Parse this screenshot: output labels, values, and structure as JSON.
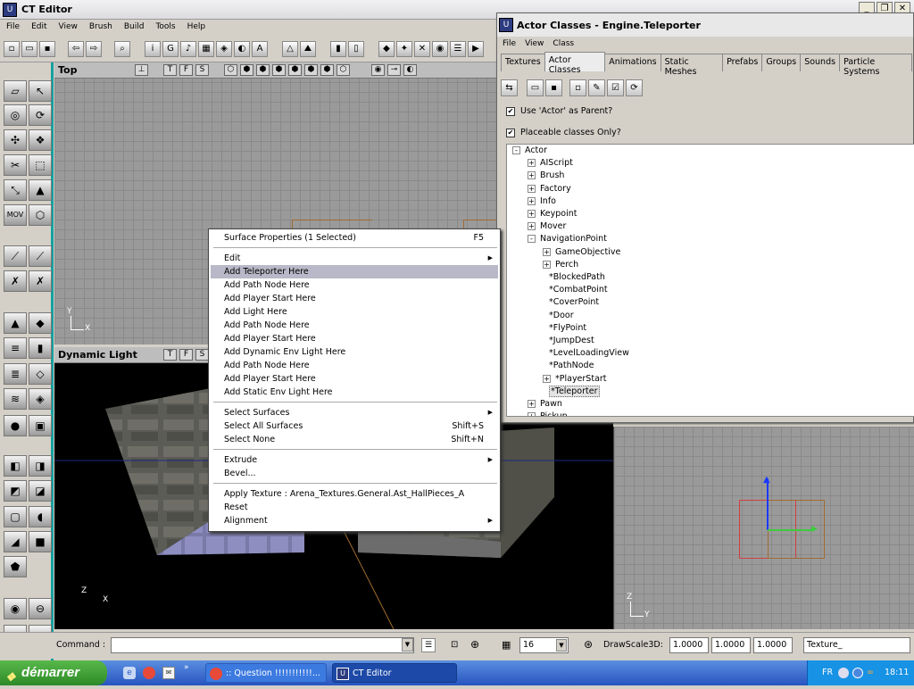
{
  "app": {
    "title": "CT Editor"
  },
  "menubar": [
    "File",
    "Edit",
    "View",
    "Brush",
    "Build",
    "Tools",
    "Help"
  ],
  "viewports": {
    "top": {
      "name": "Top",
      "buttons": [
        "T",
        "F",
        "S"
      ],
      "axis_y": "Y",
      "axis_x": "X"
    },
    "dynamic": {
      "name": "Dynamic Light",
      "buttons": [
        "T",
        "F",
        "S"
      ]
    },
    "side": {
      "axis_z": "Z",
      "axis_y": "Y"
    }
  },
  "actor_classes": {
    "title": "Actor Classes - Engine.Teleporter",
    "menu": [
      "File",
      "View",
      "Class"
    ],
    "tabs": [
      "Textures",
      "Actor Classes",
      "Animations",
      "Static Meshes",
      "Prefabs",
      "Groups",
      "Sounds",
      "Particle Systems"
    ],
    "active_tab": "Actor Classes",
    "use_actor_parent": "Use 'Actor' as Parent?",
    "placeable_only": "Placeable classes Only?",
    "tree": [
      {
        "label": "Actor",
        "level": 0,
        "expander": "-"
      },
      {
        "label": "AIScript",
        "level": 1,
        "expander": "+"
      },
      {
        "label": "Brush",
        "level": 1,
        "expander": "+"
      },
      {
        "label": "Factory",
        "level": 1,
        "expander": "+"
      },
      {
        "label": "Info",
        "level": 1,
        "expander": "+"
      },
      {
        "label": "Keypoint",
        "level": 1,
        "expander": "+"
      },
      {
        "label": "Mover",
        "level": 1,
        "expander": "+"
      },
      {
        "label": "NavigationPoint",
        "level": 1,
        "expander": "-"
      },
      {
        "label": "GameObjective",
        "level": 2,
        "expander": "+"
      },
      {
        "label": "Perch",
        "level": 2,
        "expander": "+"
      },
      {
        "label": "*BlockedPath",
        "level": 2,
        "expander": ""
      },
      {
        "label": "*CombatPoint",
        "level": 2,
        "expander": ""
      },
      {
        "label": "*CoverPoint",
        "level": 2,
        "expander": ""
      },
      {
        "label": "*Door",
        "level": 2,
        "expander": ""
      },
      {
        "label": "*FlyPoint",
        "level": 2,
        "expander": ""
      },
      {
        "label": "*JumpDest",
        "level": 2,
        "expander": ""
      },
      {
        "label": "*LevelLoadingView",
        "level": 2,
        "expander": ""
      },
      {
        "label": "*PathNode",
        "level": 2,
        "expander": ""
      },
      {
        "label": "*PlayerStart",
        "level": 2,
        "expander": "+"
      },
      {
        "label": "*Teleporter",
        "level": 2,
        "expander": "",
        "selected": true
      },
      {
        "label": "Pawn",
        "level": 1,
        "expander": "+"
      },
      {
        "label": "Pickup",
        "level": 1,
        "expander": "+"
      }
    ]
  },
  "context_menu": {
    "items": [
      {
        "label": "Surface Properties (1 Selected)",
        "shortcut": "F5"
      },
      {
        "sep": true
      },
      {
        "label": "Edit",
        "submenu": true
      },
      {
        "label": "Add Teleporter Here",
        "highlight": true
      },
      {
        "label": "Add Path Node Here"
      },
      {
        "label": "Add Player Start Here"
      },
      {
        "label": "Add Light Here"
      },
      {
        "label": "Add Path Node Here"
      },
      {
        "label": "Add Player Start Here"
      },
      {
        "label": "Add Dynamic Env Light Here"
      },
      {
        "label": "Add Path Node Here"
      },
      {
        "label": "Add Player Start Here"
      },
      {
        "label": "Add Static Env Light Here"
      },
      {
        "sep": true
      },
      {
        "label": "Select Surfaces",
        "submenu": true
      },
      {
        "label": "Select All Surfaces",
        "shortcut": "Shift+S"
      },
      {
        "label": "Select None",
        "shortcut": "Shift+N"
      },
      {
        "sep": true
      },
      {
        "label": "Extrude",
        "submenu": true
      },
      {
        "label": "Bevel..."
      },
      {
        "sep": true
      },
      {
        "label": "Apply Texture : Arena_Textures.General.Ast_HallPieces_A"
      },
      {
        "label": "Reset"
      },
      {
        "label": "Alignment",
        "submenu": true
      }
    ]
  },
  "statusbar": {
    "command_label": "Command :",
    "grid_value": "16",
    "drawscale_label": "DrawScale3D:",
    "scale_x": "1.0000",
    "scale_y": "1.0000",
    "scale_z": "1.0000",
    "texture_value": "Texture_"
  },
  "taskbar": {
    "start": "démarrer",
    "tasks": [
      ":: Question !!!!!!!!!!!...",
      "CT Editor"
    ],
    "lang": "FR",
    "clock": "18:11"
  },
  "colors": {
    "panel_accent": "#14a0a0",
    "menu_highlight": "#b8b8c8",
    "start_green": "#3a9a33"
  }
}
